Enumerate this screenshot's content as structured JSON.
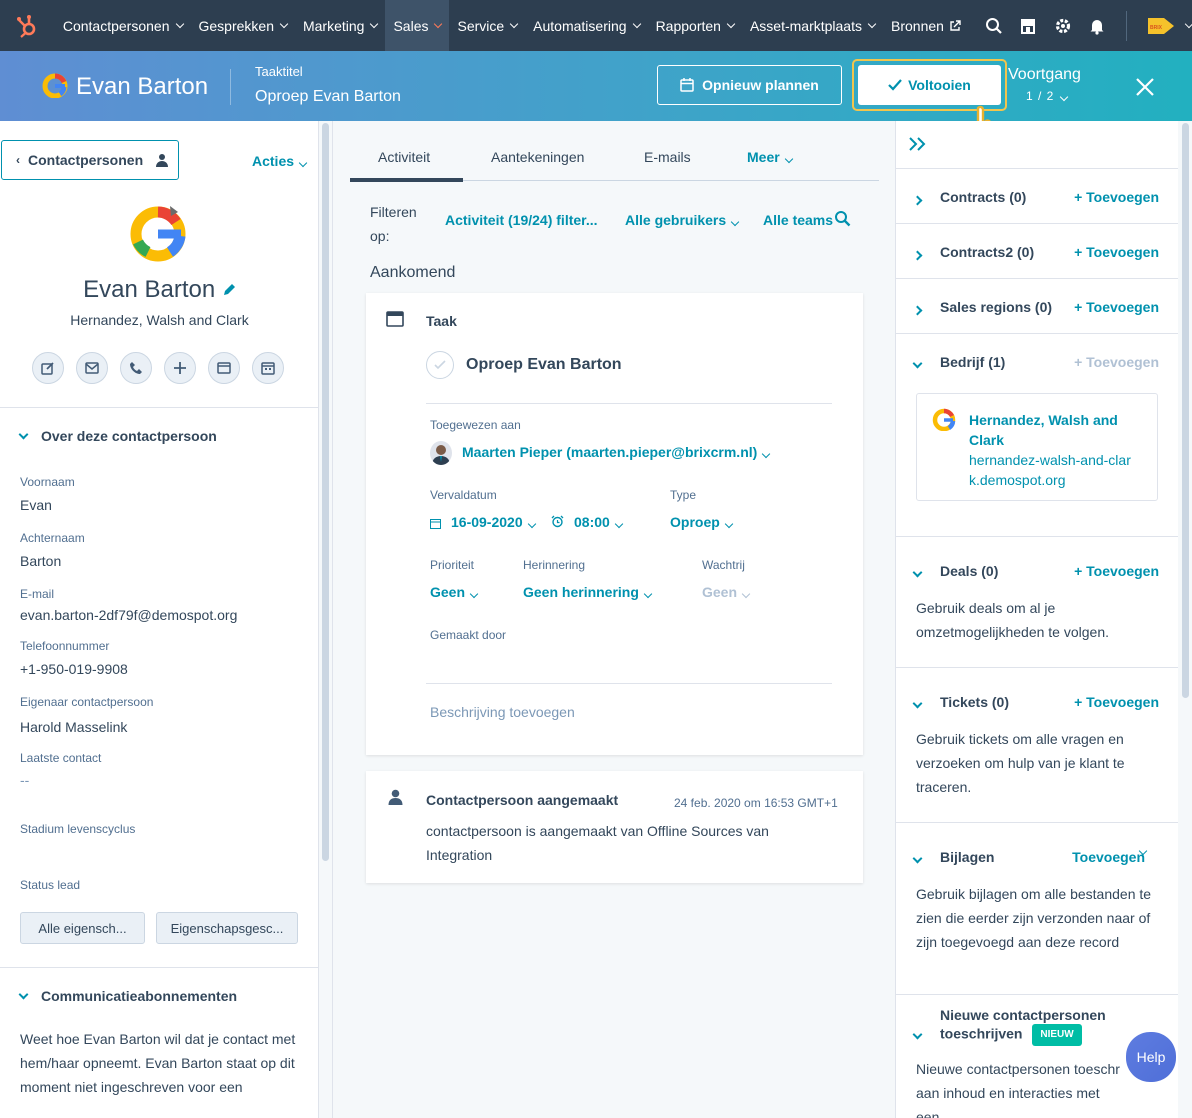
{
  "nav": {
    "items": [
      {
        "label": "Contactpersonen",
        "active": false
      },
      {
        "label": "Gesprekken",
        "active": false
      },
      {
        "label": "Marketing",
        "active": false
      },
      {
        "label": "Sales",
        "active": true
      },
      {
        "label": "Service",
        "active": false
      },
      {
        "label": "Automatisering",
        "active": false
      },
      {
        "label": "Rapporten",
        "active": false
      },
      {
        "label": "Asset-marktplaats",
        "active": false
      }
    ],
    "bronnen": "Bronnen",
    "icons": [
      "search-icon",
      "marketplace-icon",
      "settings-icon",
      "bell-icon"
    ],
    "brand_color": "#ff7a59"
  },
  "header": {
    "contact_name": "Evan Barton",
    "task_label": "Taaktitel",
    "task_title": "Oproep Evan Barton",
    "reschedule": "Opnieuw plannen",
    "complete": "Voltooien",
    "progress_label": "Voortgang",
    "progress": "1 / 2"
  },
  "left": {
    "contacts_button": "Contactpersonen",
    "actions": "Acties",
    "name": "Evan Barton",
    "company": "Hernandez, Walsh and Clark",
    "about_title": "Over deze contactpersoon",
    "fields": [
      {
        "label": "Voornaam",
        "value": "Evan"
      },
      {
        "label": "Achternaam",
        "value": "Barton"
      },
      {
        "label": "E-mail",
        "value": "evan.barton-2df79f@demospot.org"
      },
      {
        "label": "Telefoonnummer",
        "value": "+1-950-019-9908"
      },
      {
        "label": "Eigenaar contactpersoon",
        "value": "Harold Masselink"
      },
      {
        "label": "Laatste contact",
        "value": "--"
      },
      {
        "label": "Stadium levenscyclus",
        "value": ""
      },
      {
        "label": "Status lead",
        "value": ""
      }
    ],
    "all_props": "Alle eigensch...",
    "props_history": "Eigenschapsgesc...",
    "subs_title": "Communicatieabonnementen",
    "subs_text": "Weet hoe Evan Barton wil dat je contact met hem/haar opneemt. Evan Barton staat op dit moment niet ingeschreven voor een"
  },
  "middle": {
    "tabs": [
      "Activiteit",
      "Aantekeningen",
      "E-mails",
      "Meer"
    ],
    "filter_label": "Filteren op:",
    "filter_activity": "Activiteit (19/24) filter...",
    "filter_users": "Alle gebruikers",
    "filter_teams": "Alle teams",
    "upcoming": "Aankomend",
    "task": {
      "type_label": "Taak",
      "title": "Oproep Evan Barton",
      "assigned_label": "Toegewezen aan",
      "assigned_value": "Maarten Pieper (maarten.pieper@brixcrm.nl)",
      "due_label": "Vervaldatum",
      "due_date": "16-09-2020",
      "due_time": "08:00",
      "type_field_label": "Type",
      "type_value": "Oproep",
      "priority_label": "Prioriteit",
      "priority_value": "Geen",
      "reminder_label": "Herinnering",
      "reminder_value": "Geen herinnering",
      "queue_label": "Wachtrij",
      "queue_value": "Geen",
      "made_by_label": "Gemaakt door",
      "description_placeholder": "Beschrijving toevoegen"
    },
    "created": {
      "title": "Contactpersoon aangemaakt",
      "date": "24 feb. 2020 om 16:53 GMT+1",
      "text": "contactpersoon is aangemaakt van Offline Sources van Integration"
    }
  },
  "right": {
    "sections": [
      {
        "title": "Contracts (0)",
        "add": "+ Toevoegen"
      },
      {
        "title": "Contracts2 (0)",
        "add": "+ Toevoegen"
      },
      {
        "title": "Sales regions (0)",
        "add": "+ Toevoegen"
      }
    ],
    "company_section": {
      "title": "Bedrijf (1)",
      "add": "+ Toevoegen",
      "company_name": "Hernandez, Walsh and Clark",
      "company_domain": "hernandez-walsh-and-clark.demospot.org"
    },
    "deals": {
      "title": "Deals (0)",
      "add": "+ Toevoegen",
      "text": "Gebruik deals om al je omzetmogelijkheden te volgen."
    },
    "tickets": {
      "title": "Tickets (0)",
      "add": "+ Toevoegen",
      "text": "Gebruik tickets om alle vragen en verzoeken om hulp van je klant te traceren."
    },
    "attachments": {
      "title": "Bijlagen",
      "add": "Toevoegen",
      "text": "Gebruik bijlagen om alle bestanden te zien die eerder zijn verzonden naar of zijn toegevoegd aan deze record"
    },
    "new_contacts": {
      "title": "Nieuwe contactpersonen toeschrijven",
      "badge": "NIEUW",
      "text": "Nieuwe contactpersonen toeschr aan inhoud en interacties met een"
    }
  },
  "help": "Help"
}
